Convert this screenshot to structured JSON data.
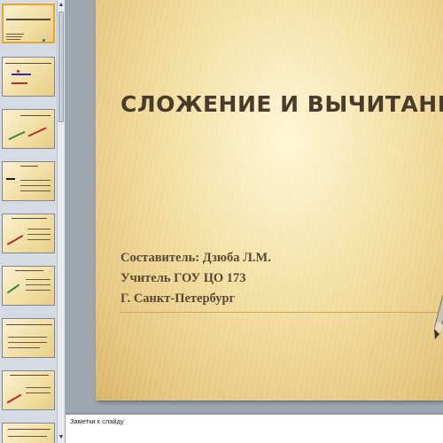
{
  "thumbnails": {
    "count": 9,
    "active_index": 0
  },
  "slide": {
    "title": "СЛОЖЕНИЕ И ВЫЧИТАНИЕ ВЕКТ",
    "subtitle_lines": [
      "Составитель: Дзюба Л.М.",
      "Учитель ГОУ ЦО 173",
      "Г. Санкт-Петербург"
    ]
  },
  "notes": {
    "placeholder": "Заметки к слайду"
  },
  "colors": {
    "slide_bg": "#f4e1a6",
    "title": "#4a3a2c",
    "subtitle": "#5a4832",
    "active_thumb_border": "#e2a92d"
  },
  "icons": {
    "scroll_up": "▲",
    "scroll_down": "▼"
  }
}
